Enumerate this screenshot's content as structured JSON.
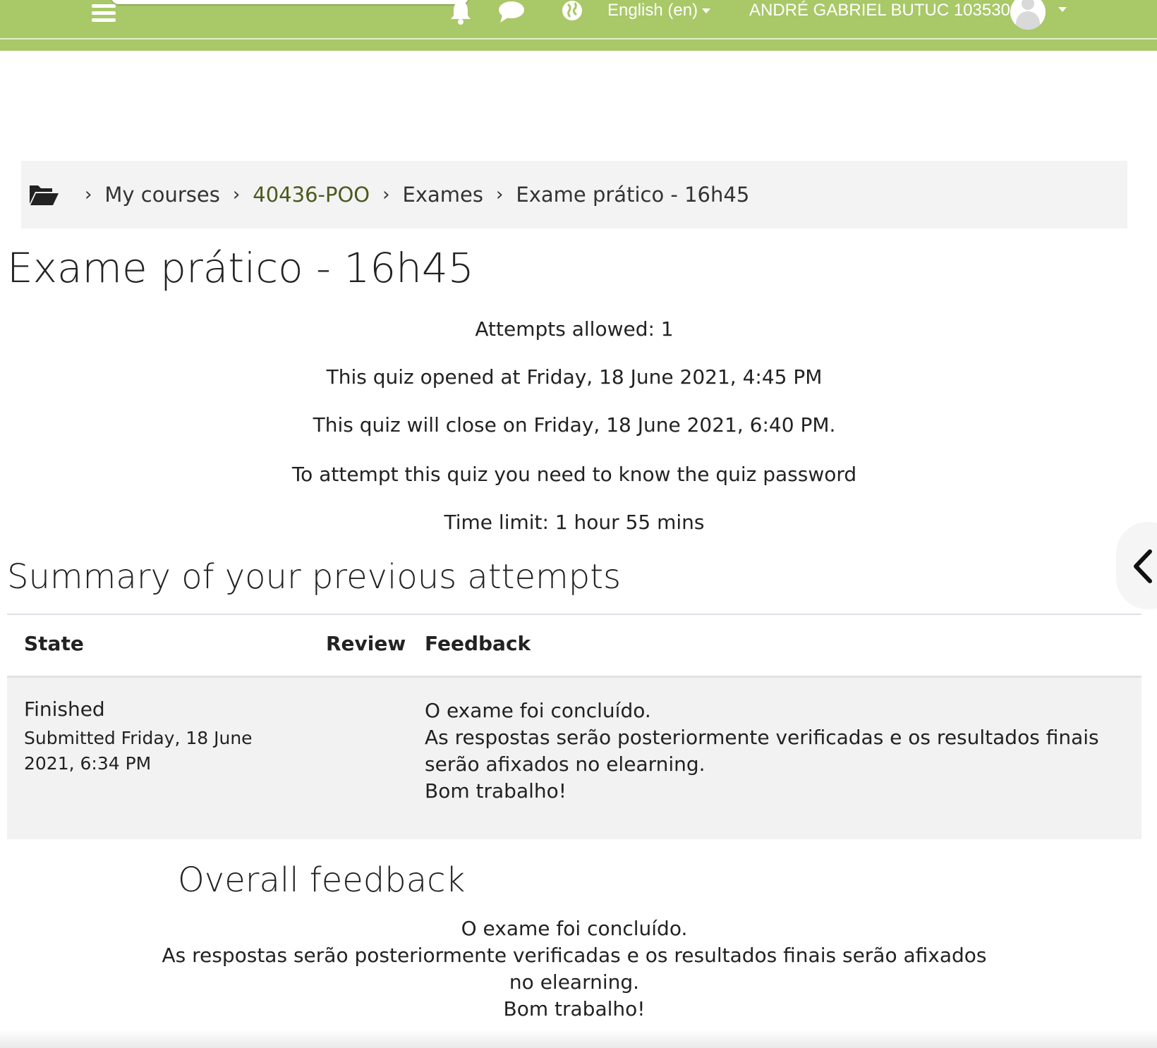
{
  "navbar": {
    "menu_icon": "hamburger-icon",
    "notifications_icon": "bell-icon",
    "messages_icon": "chat-icon",
    "language_icon": "globe-icon",
    "language_label": "English (en)",
    "user_name": "ANDRÉ GABRIEL BUTUC 103530",
    "avatar_icon": "user-avatar-icon",
    "colors": {
      "navbar_bg": "#a9c868",
      "text": "#ffffff"
    }
  },
  "breadcrumb": {
    "home_icon": "folder-open-icon",
    "items": [
      "My courses",
      "40436-POO",
      "Exames",
      "Exame prático - 16h45"
    ],
    "separator": "›"
  },
  "page": {
    "title": "Exame prático - 16h45",
    "info": [
      "Attempts allowed: 1",
      "This quiz opened at Friday, 18 June 2021, 4:45 PM",
      "This quiz will close on Friday, 18 June 2021, 6:40 PM.",
      "To attempt this quiz you need to know the quiz password",
      "Time limit: 1 hour 55 mins"
    ]
  },
  "summary": {
    "title": "Summary of your previous attempts",
    "columns": [
      "State",
      "Review",
      "Feedback"
    ],
    "rows": [
      {
        "state": "Finished",
        "submitted": "Submitted Friday, 18 June 2021, 6:34 PM",
        "review": "",
        "feedback": [
          "O exame foi concluído.",
          "As respostas serão posteriormente verificadas e os resultados finais",
          "serão afixados no elearning.",
          "Bom trabalho!"
        ]
      }
    ]
  },
  "overall": {
    "title": "Overall feedback",
    "lines": [
      "O exame foi concluído.",
      "As respostas serão posteriormente verificadas e os resultados finais serão afixados",
      "no elearning.",
      "Bom trabalho!"
    ]
  },
  "drawer": {
    "toggle_icon": "chevron-left-icon"
  }
}
